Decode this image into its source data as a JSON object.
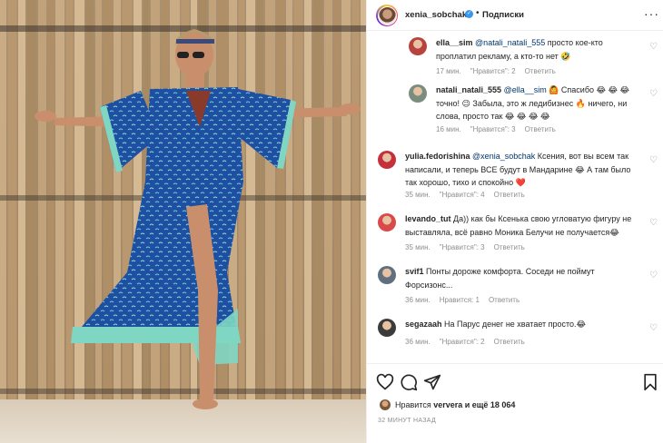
{
  "header": {
    "username": "xenia_sobchak",
    "verified_mark": "✓",
    "separator": "•",
    "follow_label": "Подписки",
    "more_label": "···"
  },
  "comments": [
    {
      "username": "ella__sim",
      "mention": "@natali_natali_555",
      "text": " просто кое-кто проплатил рекламу, а кто-то нет",
      "emoji": "🤣",
      "time": "17 мин.",
      "likes": "\"Нравится\": 2",
      "reply": "Ответить",
      "avatar_color": "#b8433e",
      "is_reply": true
    },
    {
      "username": "natali_natali_555",
      "mention": "@ella__sim",
      "text": " 🙆 Спасибо 😂 😂 😂 точно! 😉 Забыла, это ж ледибизнес 🔥 ничего, ни слова, просто так 😂 😂 😂 😂",
      "time": "16 мин.",
      "likes": "\"Нравится\": 3",
      "reply": "Ответить",
      "avatar_color": "#7a8d7e",
      "is_reply": true
    },
    {
      "username": "yulia.fedorishina",
      "mention": "@xenia_sobchak",
      "text": " Ксения, вот вы всем так написали, и теперь ВСЕ будут в Мандарине 😂 А там было так хорошо, тихо и спокойно ❤️",
      "time": "35 мин.",
      "likes": "\"Нравится\": 4",
      "reply": "Ответить",
      "avatar_color": "#c4313d"
    },
    {
      "username": "levando_tut",
      "mention": "",
      "text": " Да)) как бы Ксенька свою угловатую фигуру не выставляла, всё равно Моника Белучи не получается😂",
      "time": "35 мин.",
      "likes": "\"Нравится\": 3",
      "reply": "Ответить",
      "avatar_color": "#d94a4a"
    },
    {
      "username": "svif1",
      "mention": "",
      "text": " Понты дороже комфорта. Соседи не поймут Форсизонс...",
      "time": "36 мин.",
      "likes": "Нравится: 1",
      "reply": "Ответить",
      "avatar_color": "#5f6f80"
    },
    {
      "username": "segazaah",
      "mention": "",
      "text": " На Парус денег не хватает просто.😂",
      "time": "36 мин.",
      "likes": "\"Нравится\": 2",
      "reply": "Ответить",
      "avatar_color": "#3b3b3b"
    }
  ],
  "actions": {
    "like_icon": "heart-outline-icon",
    "comment_icon": "comment-bubble-icon",
    "share_icon": "paper-plane-icon",
    "save_icon": "bookmark-icon"
  },
  "likes": {
    "prefix": "Нравится ",
    "user": "ververa",
    "suffix": " и ещё 18 064"
  },
  "timestamp": "32 МИНУТ НАЗАД",
  "colors": {
    "verified": "#3897f0",
    "mention": "#00376b",
    "muted": "#8e8e8e",
    "dress": "#1f4fa3",
    "fringe": "#7fd6c3",
    "fence": "#b89770"
  }
}
